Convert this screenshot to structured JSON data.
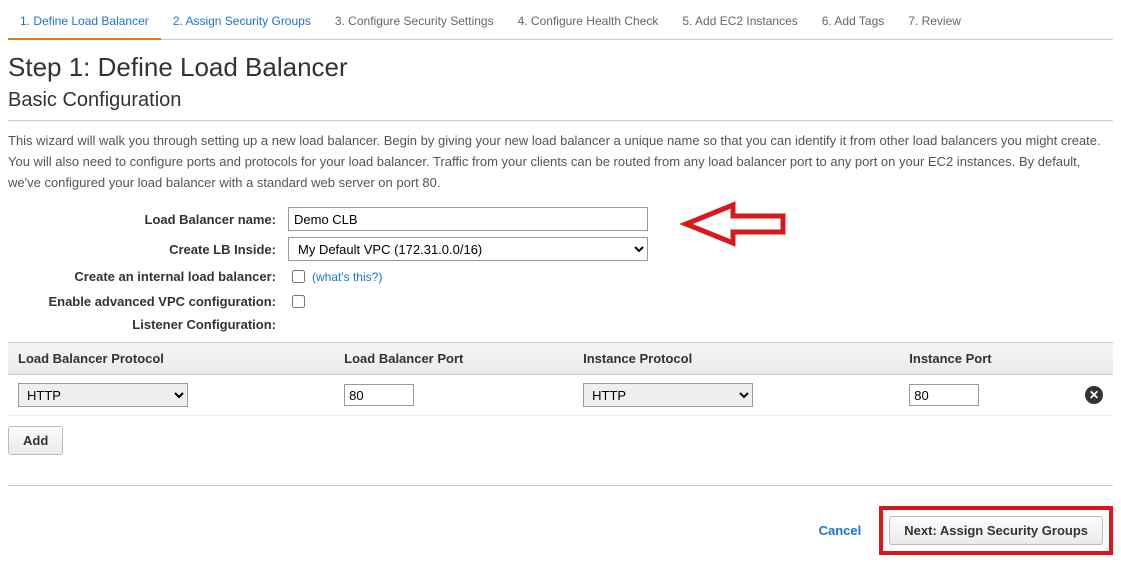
{
  "tabs": [
    {
      "label": "1. Define Load Balancer"
    },
    {
      "label": "2. Assign Security Groups"
    },
    {
      "label": "3. Configure Security Settings"
    },
    {
      "label": "4. Configure Health Check"
    },
    {
      "label": "5. Add EC2 Instances"
    },
    {
      "label": "6. Add Tags"
    },
    {
      "label": "7. Review"
    }
  ],
  "heading": "Step 1: Define Load Balancer",
  "subheading": "Basic Configuration",
  "intro": "This wizard will walk you through setting up a new load balancer. Begin by giving your new load balancer a unique name so that you can identify it from other load balancers you might create. You will also need to configure ports and protocols for your load balancer. Traffic from your clients can be routed from any load balancer port to any port on your EC2 instances. By default, we've configured your load balancer with a standard web server on port 80.",
  "form": {
    "name_label": "Load Balancer name:",
    "name_value": "Demo CLB",
    "vpc_label": "Create LB Inside:",
    "vpc_value": "My Default VPC (172.31.0.0/16)",
    "internal_label": "Create an internal load balancer:",
    "whats_this": "(what's this?)",
    "advanced_label": "Enable advanced VPC configuration:",
    "listener_label": "Listener Configuration:"
  },
  "table": {
    "headers": {
      "lb_protocol": "Load Balancer Protocol",
      "lb_port": "Load Balancer Port",
      "inst_protocol": "Instance Protocol",
      "inst_port": "Instance Port"
    },
    "row": {
      "lb_protocol": "HTTP",
      "lb_port": "80",
      "inst_protocol": "HTTP",
      "inst_port": "80"
    }
  },
  "buttons": {
    "add": "Add",
    "cancel": "Cancel",
    "next": "Next: Assign Security Groups"
  }
}
